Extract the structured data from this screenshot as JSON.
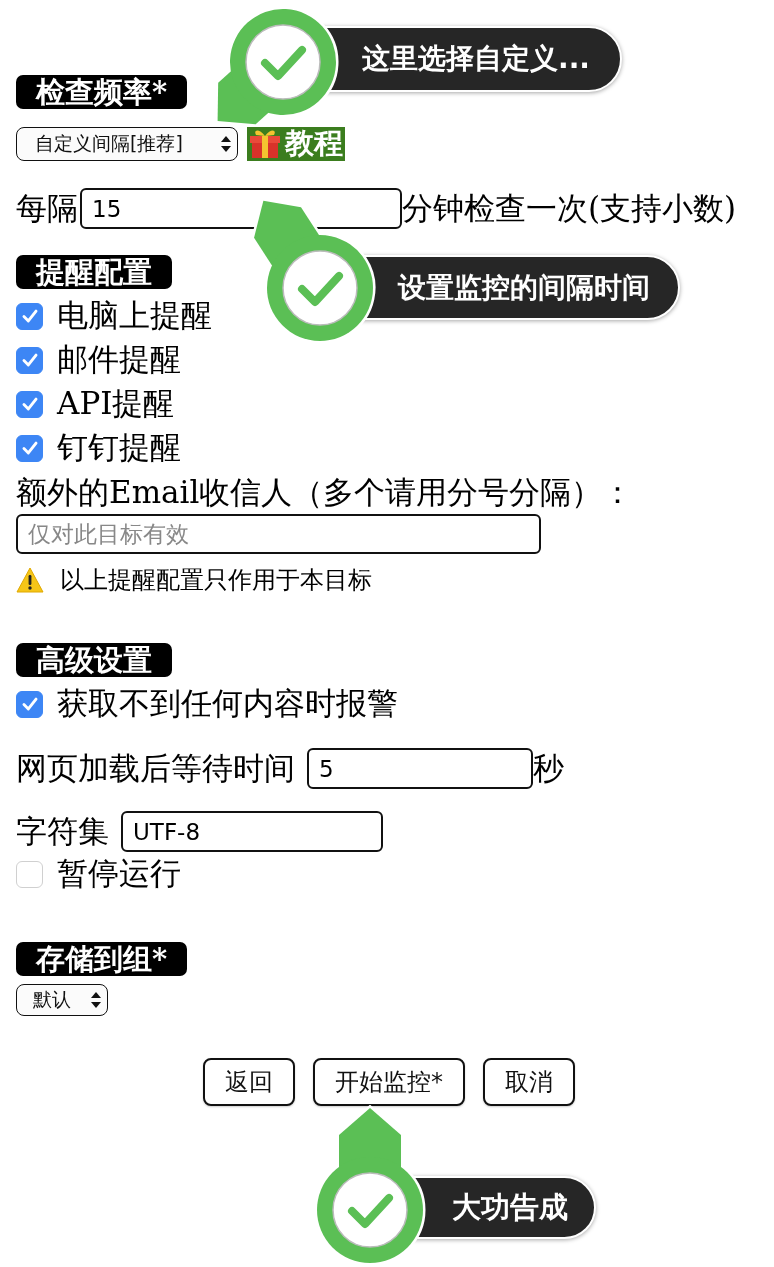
{
  "frequency": {
    "callout": "这里选择自定义...",
    "heading": "检查频率*",
    "select": "自定义间隔[推荐]",
    "tutorial_link": "教程",
    "interval": {
      "label": "每隔",
      "value": "15",
      "unit": "分钟检查一次(支持小数)",
      "callout": "设置监控的间隔时间"
    }
  },
  "alerts": {
    "heading": "提醒配置",
    "options": [
      {
        "label": "电脑上提醒",
        "checked": true
      },
      {
        "label": "邮件提醒",
        "checked": true
      },
      {
        "label": "API提醒",
        "checked": true
      },
      {
        "label": "钉钉提醒",
        "checked": true
      }
    ],
    "extra_email": {
      "label": "额外的Email收信人（多个请用分号分隔）：",
      "placeholder": "仅对此目标有效"
    },
    "note": "以上提醒配置只作用于本目标"
  },
  "advanced": {
    "heading": "高级设置",
    "items": [
      {
        "kind": "checkbox",
        "label": "获取不到任何内容时报警",
        "checked": true
      },
      {
        "kind": "field",
        "label": "网页加载后等待时间",
        "value": "5",
        "unit": "秒"
      },
      {
        "kind": "field",
        "label": "字符集",
        "value": "UTF-8"
      },
      {
        "kind": "checkbox",
        "label": "暂停运行",
        "checked": false
      }
    ]
  },
  "group": {
    "heading": "存储到组*",
    "select": "默认"
  },
  "footer": {
    "buttons": [
      "返回",
      "开始监控*",
      "取消"
    ],
    "callout": "大功告成"
  }
}
